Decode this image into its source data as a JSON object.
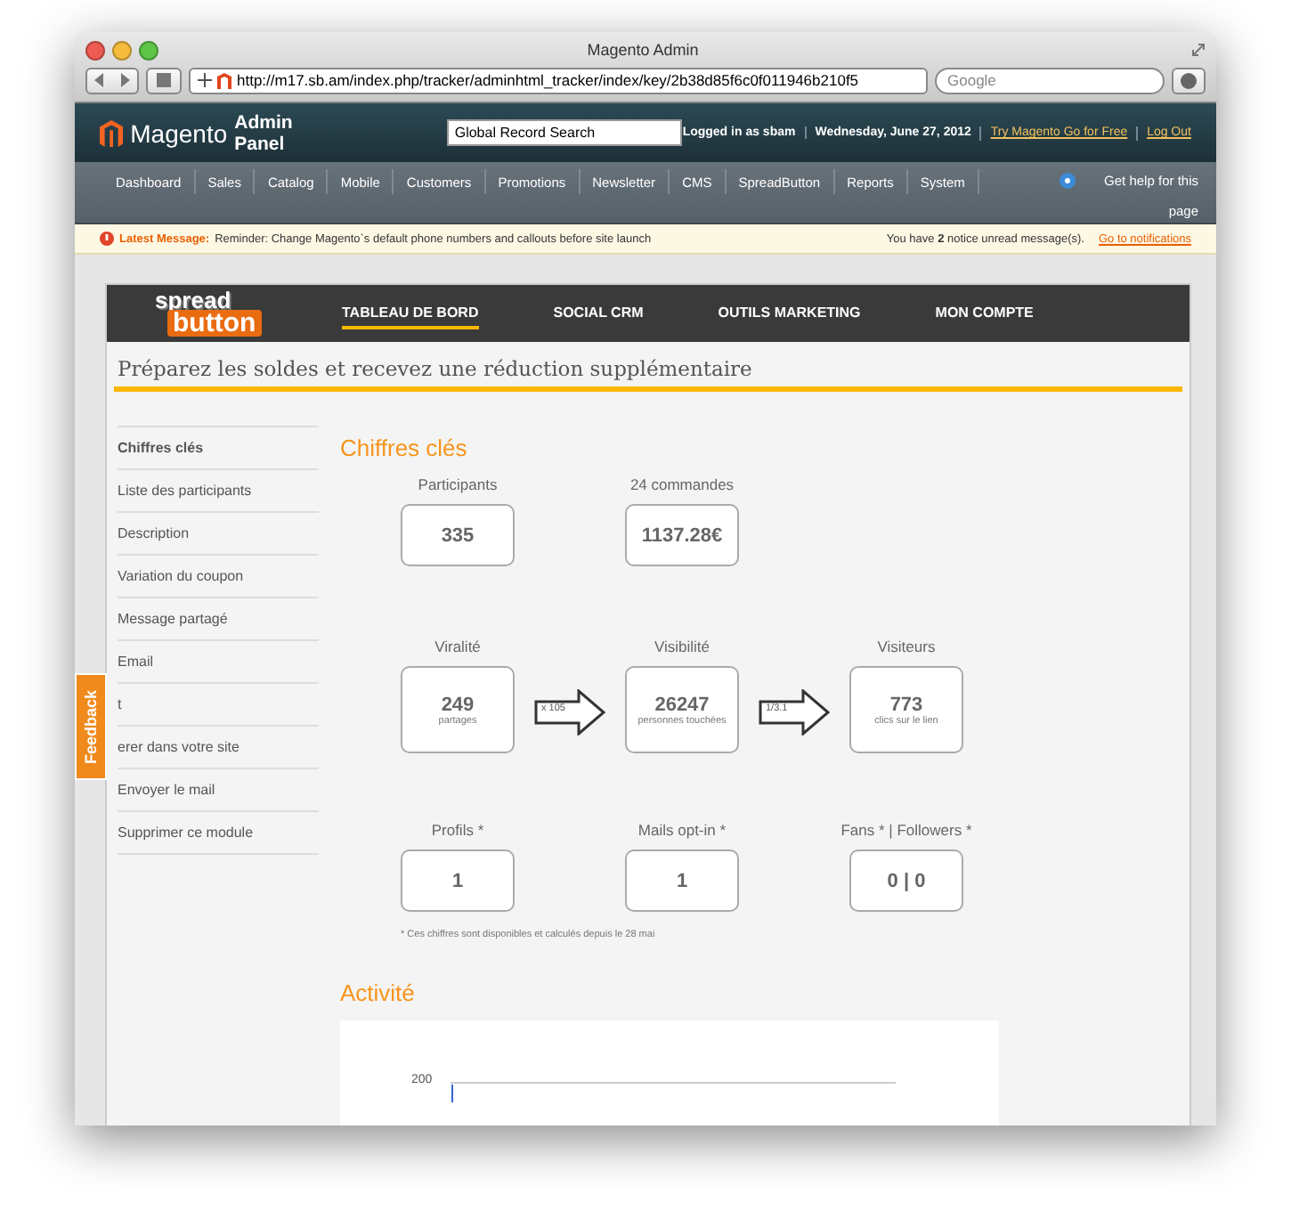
{
  "window": {
    "title": "Magento Admin"
  },
  "browser": {
    "url": "http://m17.sb.am/index.php/tracker/adminhtml_tracker/index/key/2b38d85f6c0f011946b210f5",
    "search": {
      "placeholder": "Google"
    }
  },
  "header": {
    "logo": "Magento",
    "logo_suffix": "Admin Panel",
    "search": {
      "value": "Global Record Search"
    },
    "user": "Logged in as sbam",
    "date": "Wednesday, June 27, 2012",
    "links": [
      "Try Magento Go for Free",
      "Log Out"
    ]
  },
  "nav": {
    "items": [
      "Dashboard",
      "Sales",
      "Catalog",
      "Mobile",
      "Customers",
      "Promotions",
      "Newsletter",
      "CMS",
      "SpreadButton",
      "Reports",
      "System"
    ],
    "help": "Get help for this page"
  },
  "message": {
    "label": "Latest Message:",
    "text": "Reminder: Change Magento`s default phone numbers and callouts before site launch",
    "notice": "You have **2** notice unread message(s).",
    "link": "Go to notifications"
  },
  "plugin": {
    "logo_top": "spread",
    "logo_bottom": "button",
    "tabs": [
      {
        "label": "TABLEAU DE BORD",
        "selected": true
      },
      {
        "label": "SOCIAL CRM",
        "selected": false
      },
      {
        "label": "OUTILS MARKETING",
        "selected": false
      },
      {
        "label": "MON COMPTE",
        "selected": false
      }
    ],
    "banner": "Préparez les soldes et recevez une réduction supplémentaire"
  },
  "sidebar": {
    "items": [
      {
        "label": "Chiffres clés",
        "selected": true
      },
      {
        "label": "Liste des participants",
        "selected": false
      },
      {
        "label": "Description",
        "selected": false
      },
      {
        "label": "Variation du coupon",
        "selected": false
      },
      {
        "label": "Message partagé",
        "selected": false
      },
      {
        "label": "Email",
        "selected": false
      },
      {
        "label": "t",
        "selected": false
      },
      {
        "label": "erer dans votre site",
        "selected": false
      },
      {
        "label": "Envoyer le mail",
        "selected": false
      },
      {
        "label": "Supprimer ce module",
        "selected": false
      }
    ]
  },
  "feedback": "Feedback",
  "key_figures": {
    "title": "Chiffres clés",
    "top": [
      {
        "label": "Participants",
        "value": "335"
      },
      {
        "label": "24 commandes",
        "value": "1137.28€"
      }
    ],
    "flow": [
      {
        "label": "Viralité",
        "value": "249",
        "caption": "partages"
      },
      {
        "label": "Visibilité",
        "value": "26247",
        "caption": "personnes touchées"
      },
      {
        "label": "Visiteurs",
        "value": "773",
        "caption": "clics sur le lien"
      }
    ],
    "arrows": [
      "x 105",
      "1/3.1"
    ],
    "social": [
      {
        "label": "Profils *",
        "value": "1"
      },
      {
        "label": "Mails opt-in *",
        "value": "1"
      },
      {
        "label": "Fans * | Followers *",
        "value": "0 | 0"
      }
    ],
    "footnote": "* Ces chiffres sont disponibles et calculés depuis le 28 mai"
  },
  "activity": {
    "title": "Activité",
    "axis_label": "200"
  }
}
